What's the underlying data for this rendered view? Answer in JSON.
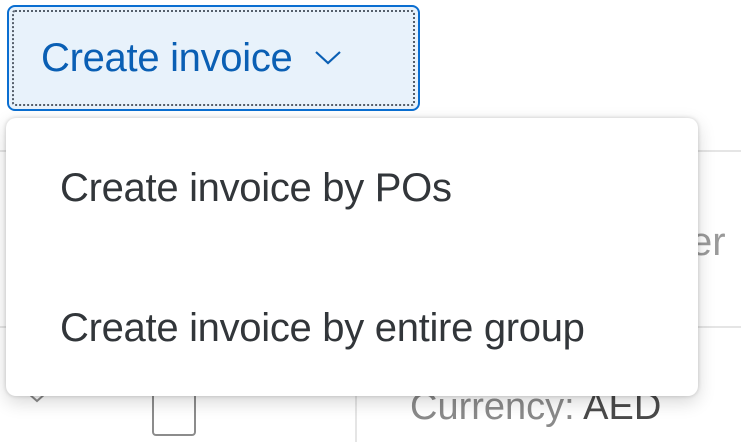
{
  "toolbar": {
    "create_invoice_label": "Create invoice",
    "create_invoice_icon": "chevron-down-icon"
  },
  "dropdown": {
    "items": [
      {
        "label": "Create invoice by POs"
      },
      {
        "label": "Create invoice by entire group"
      }
    ]
  },
  "table": {
    "header_fragment": "er",
    "row": {
      "expand_icon": "chevron-down-icon",
      "currency_label": "Currency: ",
      "currency_code": "AED"
    }
  },
  "colors": {
    "accent": "#0a6ed1",
    "button_bg": "#e8f2fb",
    "menu_text": "#32363a"
  }
}
